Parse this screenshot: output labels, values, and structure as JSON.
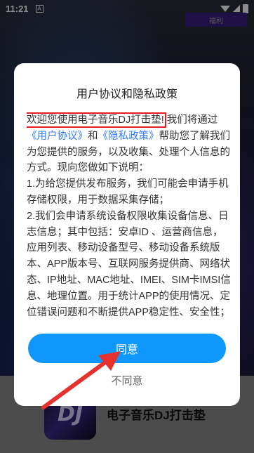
{
  "status_bar": {
    "time": "11:21",
    "notification_glyph": "A"
  },
  "top_pill": {
    "label": "福利"
  },
  "dialog": {
    "title": "用户协议和隐私政策",
    "intro_highlight": "欢迎您使用电子音乐DJ打击垫!",
    "intro_rest_1": "我们将通过",
    "user_agreement_link": "《用户协议》",
    "and": "和",
    "privacy_link": "《隐私政策》",
    "intro_rest_2": "帮助您了解我们为您提供的服务，以及收集、处理个人信息的方式。现向您做如下说明：",
    "item1": "1.为给您提供发布服务，我们可能会申请手机存储权限，用于数据采集存储；",
    "item2": "2.我们会申请系统设备权限收集设备信息、日志信息；其中包括：安卓ID 、运营商信息，应用列表、移动设备型号、移动设备系统版本、APP版本号、互联网服务提供商、网络状态、IP地址、MAC地址、IMEI、SIM卡IMSI信息、地理位置。用于统计APP的使用情况、定位错误问题和不断提供APP稳定性、安全性；",
    "agree_label": "同意",
    "disagree_label": "不同意"
  },
  "app": {
    "name": "电子音乐DJ打击垫",
    "icon_text": "DJ"
  },
  "colors": {
    "accent": "#0f97fb",
    "link": "#2e7cf6",
    "highlight_box": "#e02020",
    "arrow": "#e5322e"
  }
}
